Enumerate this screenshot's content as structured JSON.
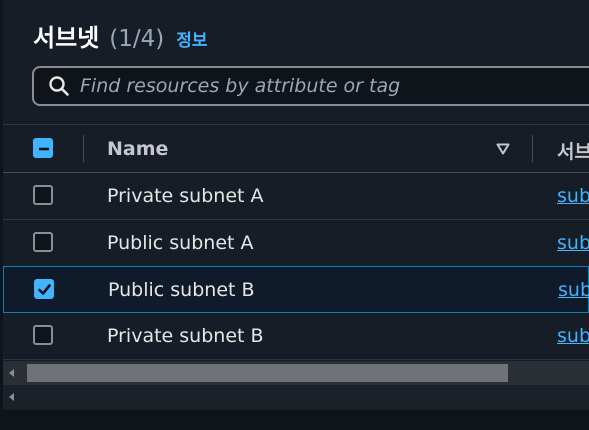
{
  "header": {
    "title": "서브넷",
    "count": "(1/4)",
    "info_link": "정보"
  },
  "search": {
    "placeholder": "Find resources by attribute or tag",
    "value": ""
  },
  "table": {
    "columns": {
      "name": "Name",
      "subnet_id": "서브"
    },
    "rows": [
      {
        "name": "Private subnet A",
        "subnet_id": "sub",
        "selected": false
      },
      {
        "name": "Public subnet A",
        "subnet_id": "sub",
        "selected": false
      },
      {
        "name": "Public subnet B",
        "subnet_id": "sub",
        "selected": true
      },
      {
        "name": "Private subnet B",
        "subnet_id": "sub",
        "selected": false
      }
    ]
  },
  "icons": {
    "search": "search-icon",
    "sort": "sort-descending-icon",
    "check": "checkmark-icon",
    "indeterminate": "minus-icon"
  },
  "colors": {
    "accent": "#42b4ff",
    "background": "#161d26",
    "selected_row": "#0f1b2a",
    "selected_border": "#0c7eb8"
  }
}
